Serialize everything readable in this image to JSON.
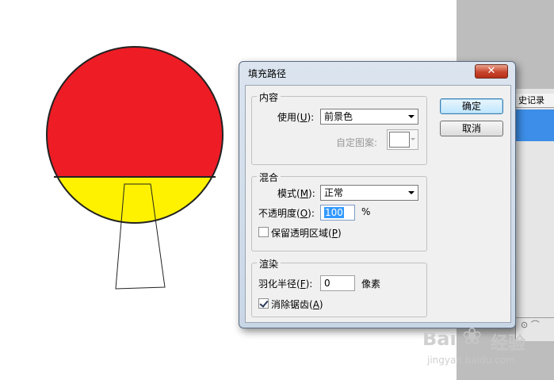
{
  "background": {
    "panel_tab_label": "史记录"
  },
  "dialog": {
    "title": "填充路径",
    "close_glyph": "✕",
    "content_group": {
      "legend": "内容",
      "use_label_pre": "使用(",
      "use_label_key": "U",
      "use_label_post": "):",
      "use_value": "前景色",
      "pattern_label": "自定图案:"
    },
    "blend_group": {
      "legend": "混合",
      "mode_label_pre": "模式(",
      "mode_label_key": "M",
      "mode_label_post": "):",
      "mode_value": "正常",
      "opacity_label_pre": "不透明度(",
      "opacity_label_key": "O",
      "opacity_label_post": "):",
      "opacity_value": "100",
      "opacity_unit": "%",
      "preserve_label_pre": "保留透明区域(",
      "preserve_label_key": "P",
      "preserve_label_post": ")",
      "preserve_checked": false
    },
    "render_group": {
      "legend": "渲染",
      "feather_label_pre": "羽化半径(",
      "feather_label_key": "F",
      "feather_label_post": "):",
      "feather_value": "0",
      "feather_unit": "像素",
      "antialias_label_pre": "消除锯齿(",
      "antialias_label_key": "A",
      "antialias_label_post": ")",
      "antialias_checked": true
    },
    "ok_label": "确定",
    "cancel_label": "取消"
  },
  "watermark": {
    "brand": "Bai",
    "brand_tail": "经验",
    "url": "jingyan.baidu.com"
  },
  "colors": {
    "paddle_red": "#ee1c25",
    "paddle_yellow": "#fff200",
    "selection_blue": "#3399ff"
  }
}
